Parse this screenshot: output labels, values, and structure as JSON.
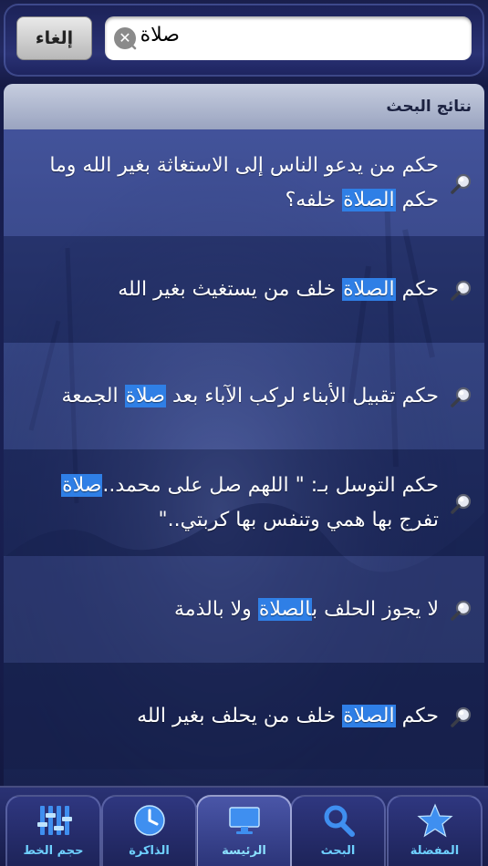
{
  "search": {
    "query": "صلاة",
    "cancel_label": "إلغاء"
  },
  "results": {
    "header": "نتائج البحث",
    "highlight_color": "#2f7fe6",
    "items": [
      {
        "parts": [
          {
            "t": "حكم من يدعو الناس إلى الاستغاثة بغير الله وما حكم "
          },
          {
            "t": "الصلاة",
            "hl": true
          },
          {
            "t": " خلفه؟"
          }
        ]
      },
      {
        "parts": [
          {
            "t": "حكم "
          },
          {
            "t": "الصلاة",
            "hl": true
          },
          {
            "t": " خلف من يستغيث بغير الله"
          }
        ]
      },
      {
        "parts": [
          {
            "t": "حكم تقبيل الأبناء لركب الآباء بعد "
          },
          {
            "t": "صلاة",
            "hl": true
          },
          {
            "t": " الجمعة"
          }
        ]
      },
      {
        "parts": [
          {
            "t": "حكم التوسل بـ: \" اللهم صل على محمد.."
          },
          {
            "t": "صلاة",
            "hl": true
          },
          {
            "t": " تفرج بها همي وتنفس بها كربتي..\""
          }
        ]
      },
      {
        "parts": [
          {
            "t": "لا يجوز الحلف ب"
          },
          {
            "t": "الصلاة",
            "hl": true
          },
          {
            "t": " ولا بالذمة"
          }
        ]
      },
      {
        "parts": [
          {
            "t": "حكم "
          },
          {
            "t": "الصلاة",
            "hl": true
          },
          {
            "t": " خلف من يحلف بغير الله"
          }
        ]
      }
    ]
  },
  "tabs": [
    {
      "label": "المفضلة",
      "icon": "star-icon",
      "active": false
    },
    {
      "label": "البحث",
      "icon": "search-icon",
      "active": false
    },
    {
      "label": "الرئيسة",
      "icon": "monitor-icon",
      "active": true
    },
    {
      "label": "الذاكرة",
      "icon": "clock-icon",
      "active": false
    },
    {
      "label": "حجم الخط",
      "icon": "sliders-icon",
      "active": false
    }
  ]
}
